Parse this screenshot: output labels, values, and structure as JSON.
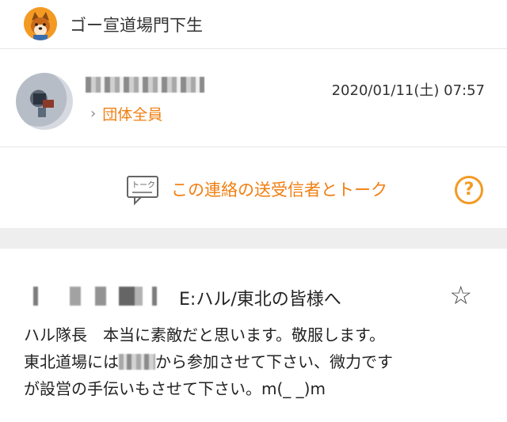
{
  "group": {
    "name": "ゴー宣道場門下生",
    "avatar_icon": "shiba-dog-icon",
    "avatar_color": "#f39a23"
  },
  "sender": {
    "role_link": "団体全員",
    "timestamp": "2020/01/11(土) 07:57"
  },
  "talk": {
    "label": "この連絡の送受信者とトーク",
    "icon_text": "トーク",
    "help_glyph": "?"
  },
  "post": {
    "title": "E:ハル/東北の皆様へ",
    "body_1": "ハル隊長　本当に素敵だと思います。敬服します。",
    "body_2a": "東北道場には",
    "body_2b": "から参加させて下さい、微力です",
    "body_3": "が設営の手伝いもさせて下さい。m(_ _)m"
  },
  "colors": {
    "accent": "#f07f12",
    "divider": "#eeeeee"
  }
}
